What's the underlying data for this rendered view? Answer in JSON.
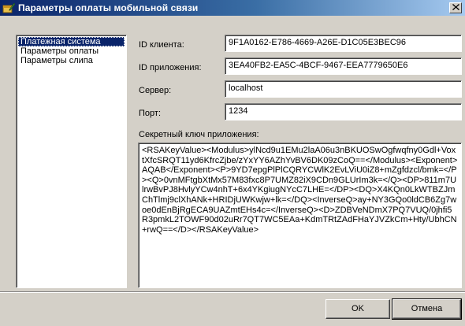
{
  "window": {
    "title": "Параметры оплаты мобильной связи",
    "close_glyph": "✕"
  },
  "nav": {
    "items": [
      {
        "label": "Платежная система",
        "selected": true
      },
      {
        "label": "Параметры оплаты",
        "selected": false
      },
      {
        "label": "Параметры слипа",
        "selected": false
      }
    ]
  },
  "form": {
    "client_id": {
      "label": "ID клиента:",
      "value": "9F1A0162-E786-4669-A26E-D1C05E3BEC96"
    },
    "app_id": {
      "label": "ID приложения:",
      "value": "3EA40FB2-EA5C-4BCF-9467-EEA7779650E6"
    },
    "server": {
      "label": "Сервер:",
      "value": "localhost"
    },
    "port": {
      "label": "Порт:",
      "value": "1234"
    },
    "secret_key": {
      "label": "Секретный ключ приложения:",
      "value": "<RSAKeyValue><Modulus>ylNcd9u1EMu2laA06u3nBKUOSwOgfwqfny0Gdl+VoxtXfcSRQT11yd6KfrcZjbe/zYxYY6AZhYvBV6DK09zCoQ==</Modulus><Exponent>AQAB</Exponent><P>9YD7epgPlPlCQRYCWlK2EvLViU0iZ8+mZgfdzcl/bmk=</P><Q>0vnMFtgbXtMx57M83fxc8P7UMZ82iX9CDn9GLUrIm3k=</Q><DP>811m7UlrwBvPJ8HvlyYCw4nhT+6x4YKgiugNYcC7LHE=</DP><DQ>X4KQn0LkWTBZJmChTlmj9clXhANk+HRIDjUWKwjw+lk=</DQ><InverseQ>ay+NY3GQo0ldCB6Zg7woe0dEnBjRgECA9UAZmtEHs4c=</InverseQ><D>ZDBVeNDmX7PQ7VUQ/0jhfi5R3pmkL2TOWF90d02uRr7QT7WC5EAa+KdmTRtZAdFHaYJVZkCm+Hty/UbhCN+rwQ==</D></RSAKeyValue>"
    }
  },
  "buttons": {
    "ok": "OK",
    "cancel": "Отмена"
  },
  "colors": {
    "window_bg": "#d4d0c8",
    "title_active": "#0a246a",
    "selection": "#0a246a"
  },
  "icons": {
    "app": "wallet-pen-icon",
    "close": "close-icon"
  }
}
